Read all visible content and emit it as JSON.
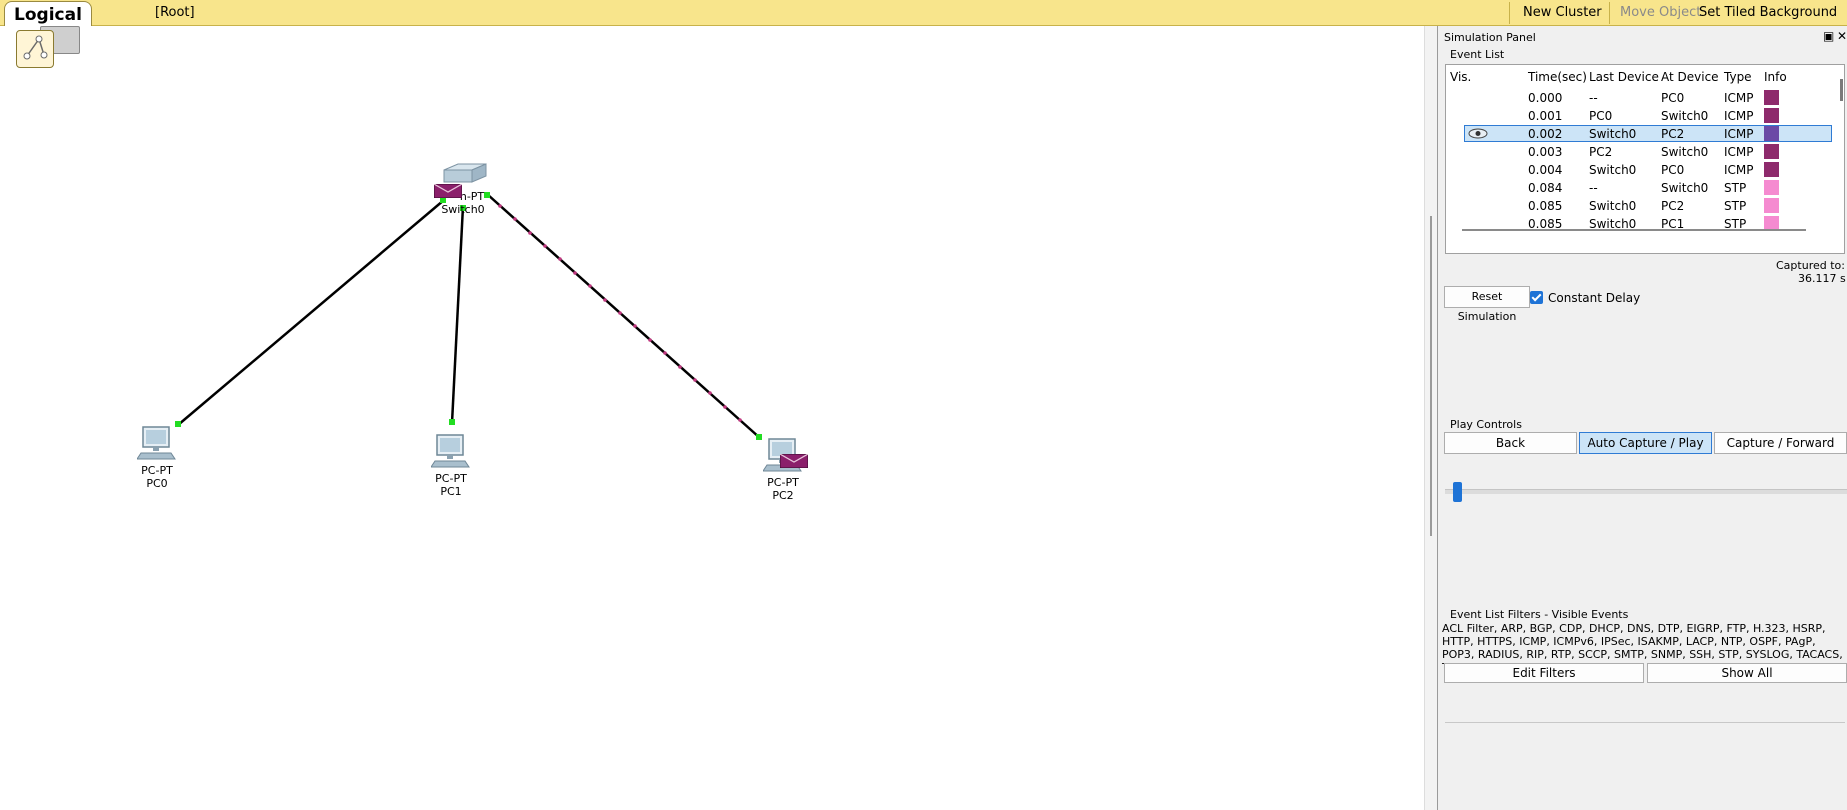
{
  "topbar": {
    "tab_label": "Logical",
    "path": "[Root]",
    "new_cluster": "New Cluster",
    "move_object": "Move Object",
    "set_tiled_background": "Set Tiled Background"
  },
  "canvas": {
    "devices": [
      {
        "id": "switch0",
        "model": "Switch-PT",
        "model_visible": "h-PT",
        "name": "Switch0"
      },
      {
        "id": "pc0",
        "model": "PC-PT",
        "name": "PC0"
      },
      {
        "id": "pc1",
        "model": "PC-PT",
        "name": "PC1"
      },
      {
        "id": "pc2",
        "model": "PC-PT",
        "name": "PC2"
      }
    ],
    "colors": {
      "link": "#000000",
      "port_up": "#22dd22",
      "envelope": "#8b1f6b",
      "packet_dot": "#c0387f"
    }
  },
  "panel": {
    "title": "Simulation Panel",
    "restore_icon": "restore-icon",
    "close_icon": "close-icon",
    "event_list": {
      "label": "Event List",
      "columns": [
        "Vis.",
        "Time(sec)",
        "Last Device",
        "At Device",
        "Type",
        "Info"
      ],
      "rows": [
        {
          "time": "0.000",
          "last": "--",
          "at": "PC0",
          "type": "ICMP",
          "color": "#8e2a6c",
          "selected": false
        },
        {
          "time": "0.001",
          "last": "PC0",
          "at": "Switch0",
          "type": "ICMP",
          "color": "#8e2a6c",
          "selected": false
        },
        {
          "time": "0.002",
          "last": "Switch0",
          "at": "PC2",
          "type": "ICMP",
          "color": "#6b4aa6",
          "selected": true
        },
        {
          "time": "0.003",
          "last": "PC2",
          "at": "Switch0",
          "type": "ICMP",
          "color": "#8e2a6c",
          "selected": false
        },
        {
          "time": "0.004",
          "last": "Switch0",
          "at": "PC0",
          "type": "ICMP",
          "color": "#8e2a6c",
          "selected": false
        },
        {
          "time": "0.084",
          "last": "--",
          "at": "Switch0",
          "type": "STP",
          "color": "#f58ad0",
          "selected": false
        },
        {
          "time": "0.085",
          "last": "Switch0",
          "at": "PC2",
          "type": "STP",
          "color": "#f58ad0",
          "selected": false
        },
        {
          "time": "0.085",
          "last": "Switch0",
          "at": "PC1",
          "type": "STP",
          "color": "#f58ad0",
          "selected": false
        }
      ]
    },
    "reset_simulation": "Reset Simulation",
    "constant_delay": "Constant Delay",
    "constant_delay_checked": true,
    "captured_label": "Captured to:",
    "captured_value": "36.117 s",
    "play_controls": {
      "label": "Play Controls",
      "back": "Back",
      "auto_capture": "Auto Capture / Play",
      "capture_forward": "Capture / Forward",
      "speed": 0.02
    },
    "filters": {
      "label": "Event List Filters - Visible Events",
      "text": "ACL Filter, ARP, BGP, CDP, DHCP, DNS, DTP, EIGRP, FTP, H.323, HSRP, HTTP, HTTPS, ICMP, ICMPv6, IPSec, ISAKMP, LACP, NTP, OSPF, PAgP, POP3, RADIUS, RIP, RTP, SCCP, SMTP, SNMP, SSH, STP, SYSLOG, TACACS, TCP, TFTP, Telnet, UDP, VTP",
      "edit_filters": "Edit Filters",
      "show_all": "Show All"
    }
  }
}
